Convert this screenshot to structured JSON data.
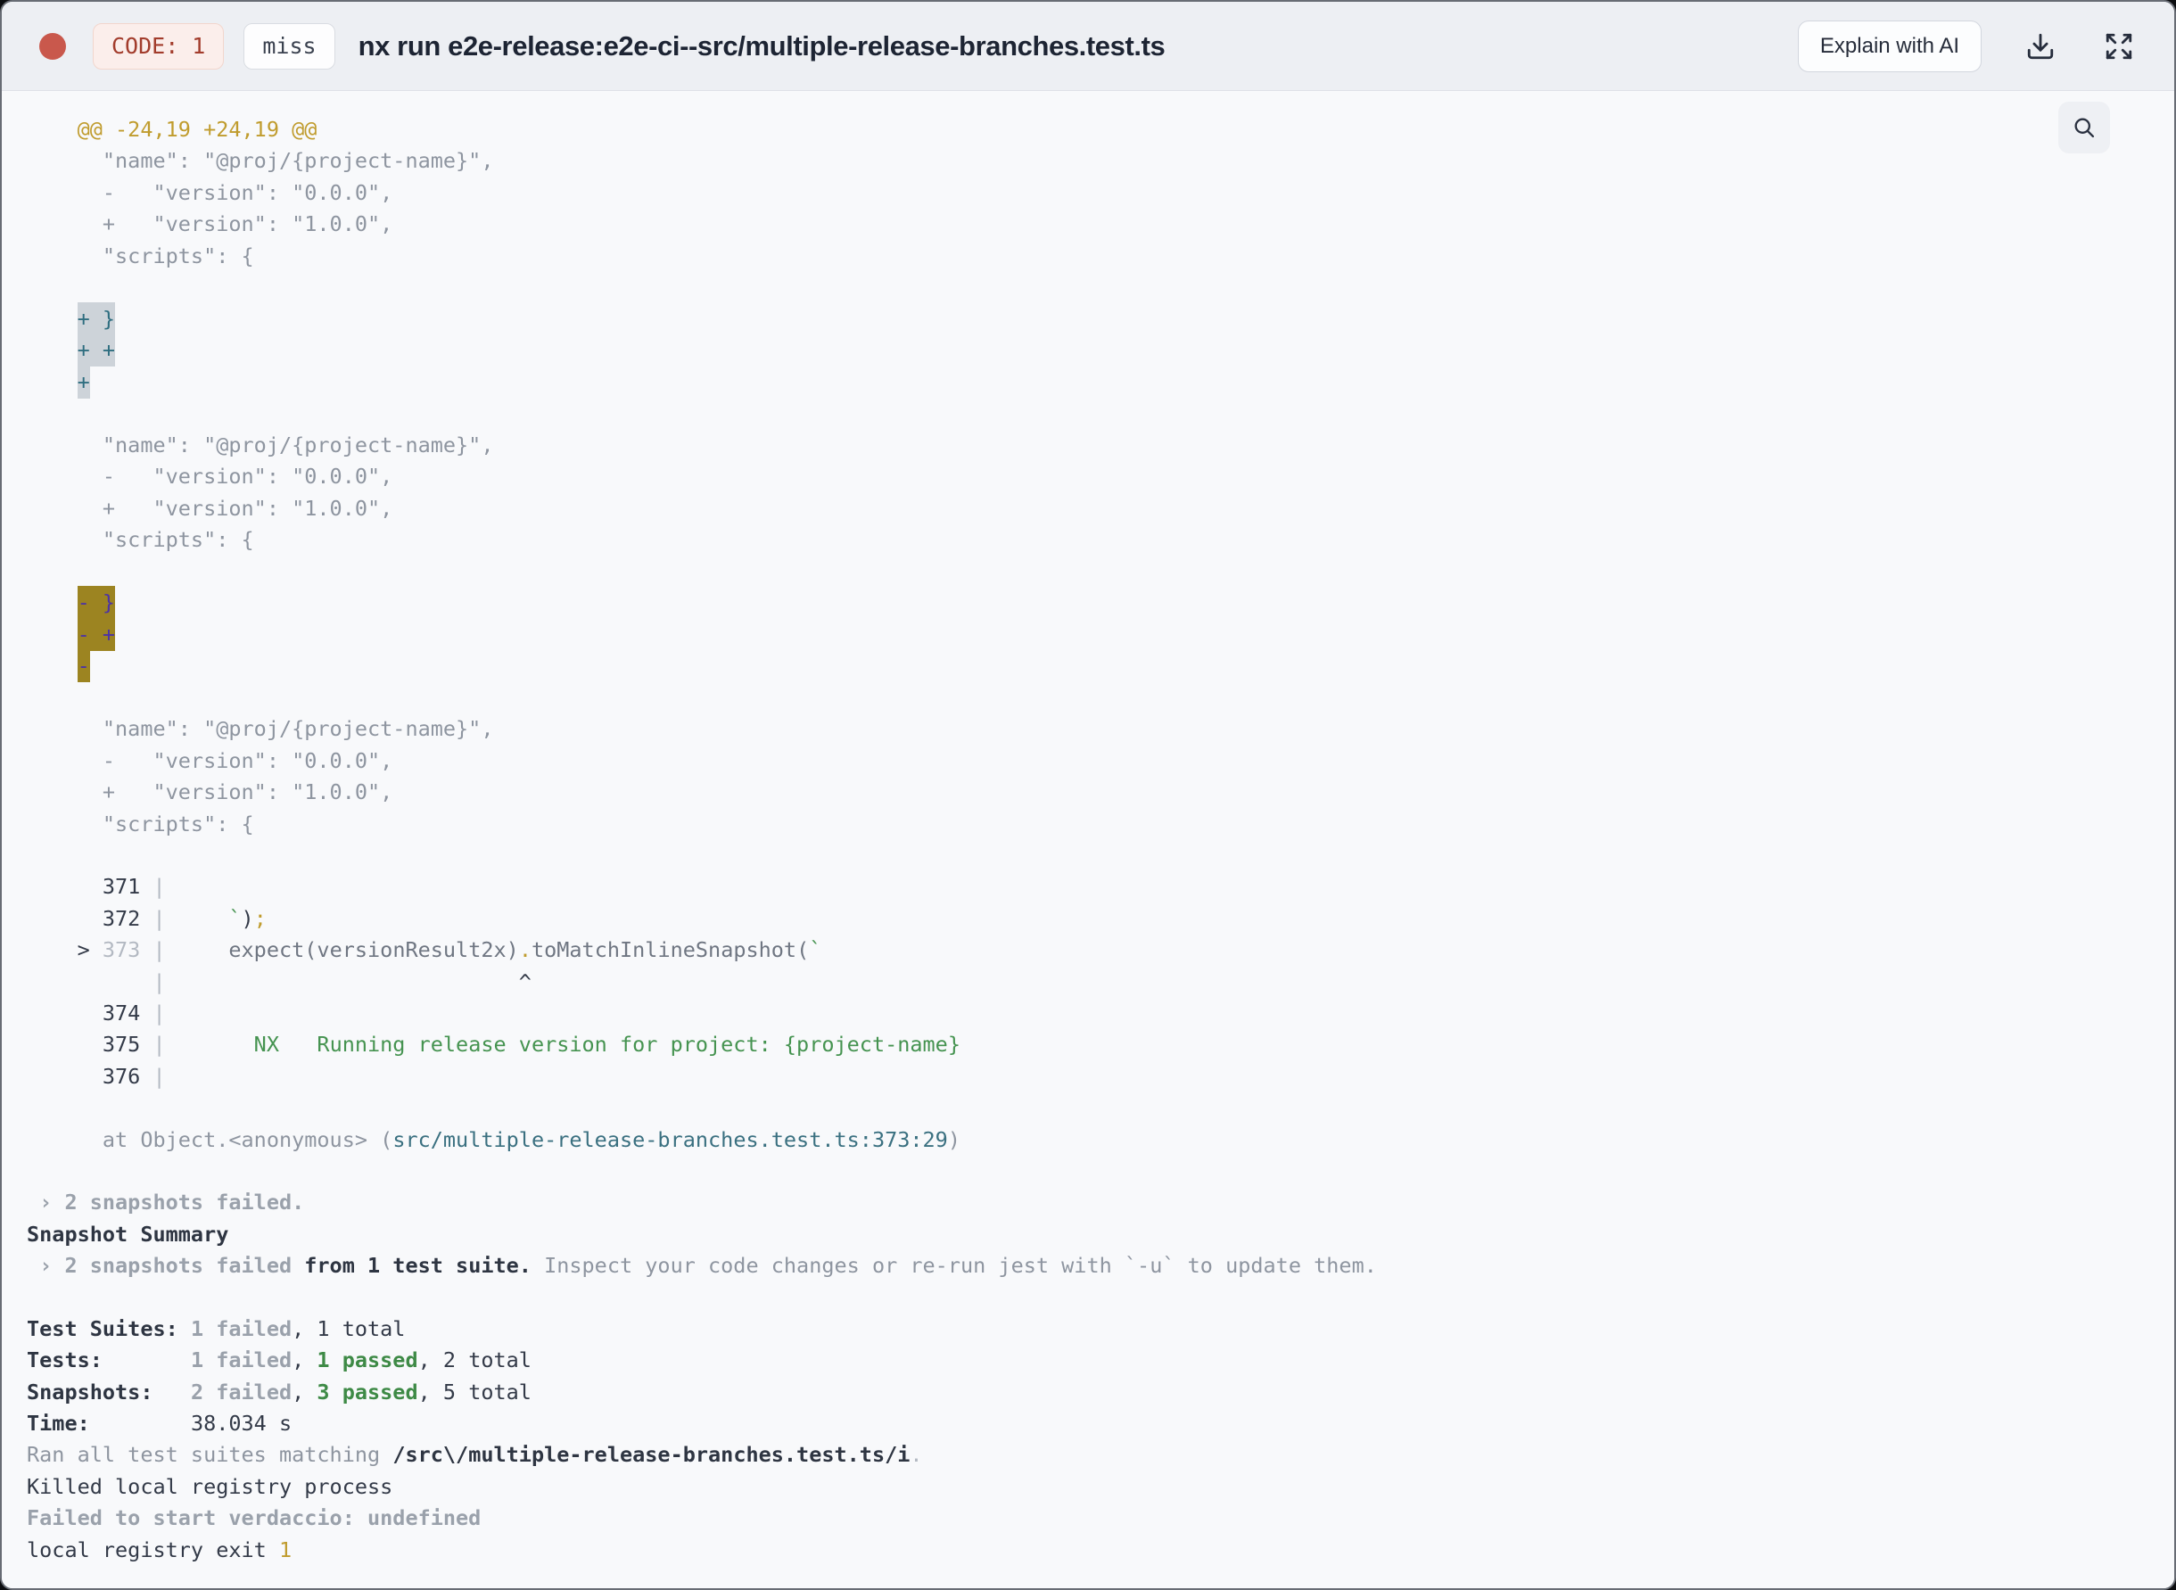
{
  "header": {
    "code_badge": "CODE: 1",
    "cache_badge": "miss",
    "title": "nx run e2e-release:e2e-ci--src/multiple-release-branches.test.ts",
    "explain_button": "Explain with AI",
    "icons": [
      "status-dot",
      "download-icon",
      "fullscreen-expand-icon",
      "search-icon"
    ]
  },
  "colors": {
    "status_red": "#c9584c",
    "code_badge_text": "#a23c2c",
    "diff_hunk_yellow": "#c09c2e",
    "pass_green": "#3e8a46",
    "snapshot_green": "#459350",
    "file_link_teal": "#3a7080",
    "selection_blue_bg": "#cdd3d9",
    "selection_blue_text": "#2f6e80",
    "selection_yellow_bg": "#9c8421",
    "selection_yellow_text": "#4c33a5"
  },
  "log": {
    "lines": [
      [
        {
          "t": "    @@ -24,19 +24,19 @@",
          "s": "yellow"
        }
      ],
      [
        {
          "t": "      \"name\": \"@proj/{project-name}\",",
          "s": "gray"
        }
      ],
      [
        {
          "t": "      -   \"version\": \"0.0.0\",",
          "s": "gray"
        }
      ],
      [
        {
          "t": "      +   \"version\": \"1.0.0\",",
          "s": "gray"
        }
      ],
      [
        {
          "t": "      \"scripts\": {",
          "s": "gray"
        }
      ],
      [],
      [
        {
          "t": "    ",
          "s": "gray"
        },
        {
          "t": "+ }",
          "s": "sel-blue"
        }
      ],
      [
        {
          "t": "    ",
          "s": "gray"
        },
        {
          "t": "+ +",
          "s": "sel-blue"
        }
      ],
      [
        {
          "t": "    ",
          "s": "gray"
        },
        {
          "t": "+",
          "s": "sel-blue"
        }
      ],
      [],
      [
        {
          "t": "      \"name\": \"@proj/{project-name}\",",
          "s": "gray"
        }
      ],
      [
        {
          "t": "      -   \"version\": \"0.0.0\",",
          "s": "gray"
        }
      ],
      [
        {
          "t": "      +   \"version\": \"1.0.0\",",
          "s": "gray"
        }
      ],
      [
        {
          "t": "      \"scripts\": {",
          "s": "gray"
        }
      ],
      [],
      [
        {
          "t": "    ",
          "s": "gray"
        },
        {
          "t": "- }",
          "s": "sel-yellow"
        }
      ],
      [
        {
          "t": "    ",
          "s": "gray"
        },
        {
          "t": "- +",
          "s": "sel-yellow"
        }
      ],
      [
        {
          "t": "    ",
          "s": "gray"
        },
        {
          "t": "-",
          "s": "sel-yellow"
        }
      ],
      [],
      [
        {
          "t": "      \"name\": \"@proj/{project-name}\",",
          "s": "gray"
        }
      ],
      [
        {
          "t": "      -   \"version\": \"0.0.0\",",
          "s": "gray"
        }
      ],
      [
        {
          "t": "      +   \"version\": \"1.0.0\",",
          "s": "gray"
        }
      ],
      [
        {
          "t": "      \"scripts\": {",
          "s": "gray"
        }
      ],
      [],
      [
        {
          "t": "      ",
          "s": "gray"
        },
        {
          "t": "371",
          "s": "dark"
        },
        {
          "t": " |",
          "s": "light"
        }
      ],
      [
        {
          "t": "      ",
          "s": "gray"
        },
        {
          "t": "372",
          "s": "dark"
        },
        {
          "t": " |",
          "s": "light"
        },
        {
          "t": "     ",
          "s": "gray"
        },
        {
          "t": "`",
          "s": "green"
        },
        {
          "t": ")",
          "s": "dark"
        },
        {
          "t": ";",
          "s": "yellow"
        }
      ],
      [
        {
          "t": "    > ",
          "s": "dark"
        },
        {
          "t": "373",
          "s": "light"
        },
        {
          "t": " |",
          "s": "light"
        },
        {
          "t": "     ",
          "s": "slate"
        },
        {
          "t": "expect(versionResult2x)",
          "s": "slate"
        },
        {
          "t": ".",
          "s": "yellow"
        },
        {
          "t": "toMatchInlineSnapshot(",
          "s": "slate"
        },
        {
          "t": "`",
          "s": "green"
        }
      ],
      [
        {
          "t": "          |",
          "s": "light"
        },
        {
          "t": "                            ^",
          "s": "dark"
        }
      ],
      [
        {
          "t": "      ",
          "s": "gray"
        },
        {
          "t": "374",
          "s": "dark"
        },
        {
          "t": " |",
          "s": "light"
        }
      ],
      [
        {
          "t": "      ",
          "s": "gray"
        },
        {
          "t": "375",
          "s": "dark"
        },
        {
          "t": " |",
          "s": "light"
        },
        {
          "t": "       NX   Running release version for project: {project-name}",
          "s": "green"
        }
      ],
      [
        {
          "t": "      ",
          "s": "gray"
        },
        {
          "t": "376",
          "s": "dark"
        },
        {
          "t": " |",
          "s": "light"
        }
      ],
      [],
      [
        {
          "t": "      at Object.<anonymous> (",
          "s": "gray"
        },
        {
          "t": "src/multiple-release-branches.test.ts:373:29",
          "s": "teal"
        },
        {
          "t": ")",
          "s": "gray"
        }
      ],
      [],
      [
        {
          "t": " › 2 snapshots failed.",
          "s": "gray-bold"
        }
      ],
      [
        {
          "t": "Snapshot Summary",
          "s": "dark-bold"
        }
      ],
      [
        {
          "t": " › 2 snapshots failed ",
          "s": "gray-bold"
        },
        {
          "t": "from 1 test suite.",
          "s": "dark-bold"
        },
        {
          "t": " Inspect your code changes or re-run jest with `-u` to update them.",
          "s": "gray"
        }
      ],
      [],
      [
        {
          "t": "Test Suites: ",
          "s": "dark-bold"
        },
        {
          "t": "1 failed",
          "s": "gray-bold"
        },
        {
          "t": ", 1 total",
          "s": "dark"
        }
      ],
      [
        {
          "t": "Tests:       ",
          "s": "dark-bold"
        },
        {
          "t": "1 failed",
          "s": "gray-bold"
        },
        {
          "t": ", ",
          "s": "dark"
        },
        {
          "t": "1 passed",
          "s": "green-bold"
        },
        {
          "t": ", 2 total",
          "s": "dark"
        }
      ],
      [
        {
          "t": "Snapshots:   ",
          "s": "dark-bold"
        },
        {
          "t": "2 failed",
          "s": "gray-bold"
        },
        {
          "t": ", ",
          "s": "dark"
        },
        {
          "t": "3 passed",
          "s": "green-bold"
        },
        {
          "t": ", 5 total",
          "s": "dark"
        }
      ],
      [
        {
          "t": "Time:        ",
          "s": "dark-bold"
        },
        {
          "t": "38.034 s",
          "s": "dark"
        }
      ],
      [
        {
          "t": "Ran all test suites matching ",
          "s": "gray"
        },
        {
          "t": "/src\\/multiple-release-branches.test.ts/i",
          "s": "dark-bold"
        },
        {
          "t": ".",
          "s": "light"
        }
      ],
      [
        {
          "t": "Killed local registry process",
          "s": "dark"
        }
      ],
      [
        {
          "t": "Failed to start verdaccio: undefined",
          "s": "gray-bold"
        }
      ],
      [
        {
          "t": "local registry exit ",
          "s": "dark"
        },
        {
          "t": "1",
          "s": "yellow"
        }
      ]
    ]
  }
}
